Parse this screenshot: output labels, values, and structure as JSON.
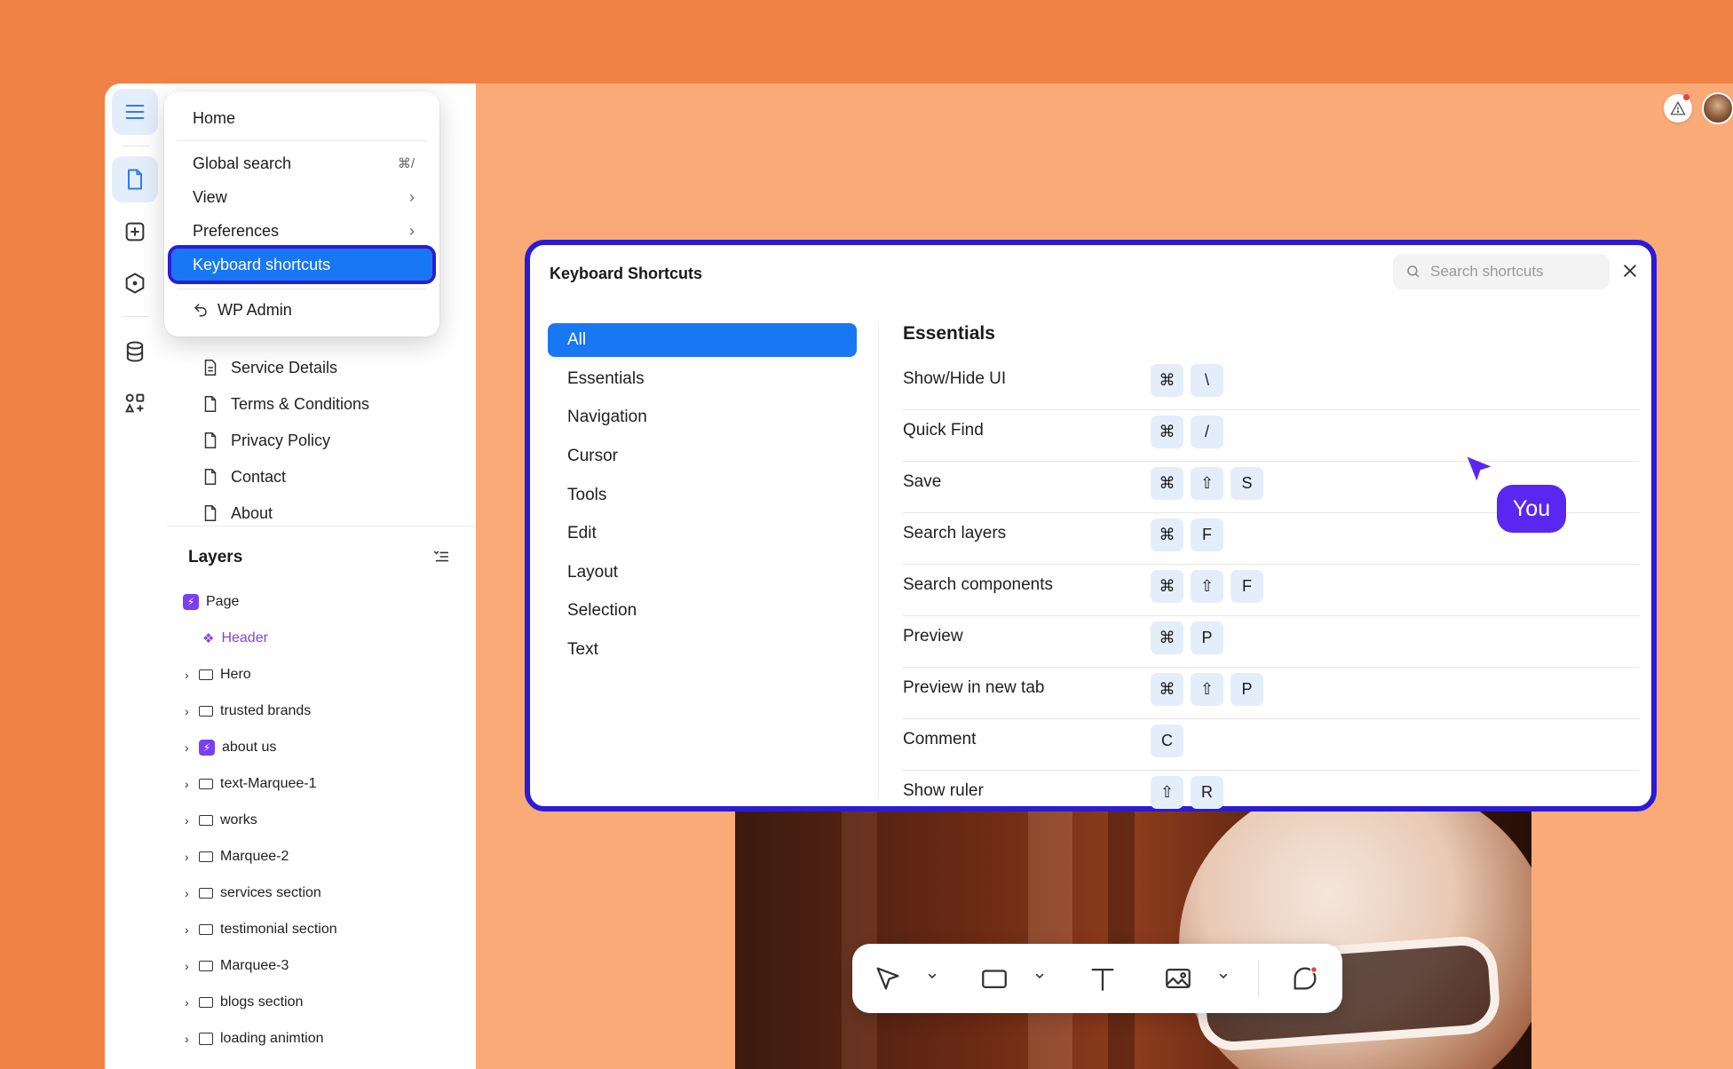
{
  "colors": {
    "background": "#F08246",
    "canvas": "#F9AA77",
    "accent": "#1877F2",
    "focus_outline": "#2A1BD6",
    "cursor": "#5B27F0",
    "component": "#8A3FE3"
  },
  "rail": {
    "items": [
      {
        "icon": "hamburger-menu-icon"
      },
      {
        "icon": "pages-document-icon"
      },
      {
        "icon": "add-square-icon"
      },
      {
        "icon": "components-hexagon-icon"
      },
      {
        "icon": "database-icon"
      },
      {
        "icon": "apps-grid-icon"
      }
    ]
  },
  "menu": {
    "home": "Home",
    "global_search": "Global search",
    "global_search_shortcut": "⌘/",
    "view": "View",
    "preferences": "Preferences",
    "submenu_arrow": "›",
    "keyboard_shortcuts": "Keyboard shortcuts",
    "wp_admin": "WP Admin"
  },
  "pages": {
    "items": [
      {
        "label": "Service Details"
      },
      {
        "label": "Terms & Conditions"
      },
      {
        "label": "Privacy Policy"
      },
      {
        "label": "Contact"
      },
      {
        "label": "About"
      }
    ]
  },
  "layers": {
    "title": "Layers",
    "items": [
      {
        "label": "Page",
        "kind": "page"
      },
      {
        "label": "Header",
        "kind": "component"
      },
      {
        "label": "Hero",
        "kind": "frame"
      },
      {
        "label": "trusted brands",
        "kind": "frame"
      },
      {
        "label": "about us",
        "kind": "bolt"
      },
      {
        "label": "text-Marquee-1",
        "kind": "frame"
      },
      {
        "label": "works",
        "kind": "frame"
      },
      {
        "label": "Marquee-2",
        "kind": "frame"
      },
      {
        "label": "services section",
        "kind": "frame"
      },
      {
        "label": "testimonial section",
        "kind": "frame"
      },
      {
        "label": "Marquee-3",
        "kind": "frame"
      },
      {
        "label": "blogs section",
        "kind": "frame"
      },
      {
        "label": "loading animtion",
        "kind": "box"
      }
    ]
  },
  "modal": {
    "title": "Keyboard Shortcuts",
    "search_placeholder": "Search shortcuts",
    "categories": [
      {
        "label": "All",
        "active": true
      },
      {
        "label": "Essentials"
      },
      {
        "label": "Navigation"
      },
      {
        "label": "Cursor"
      },
      {
        "label": "Tools"
      },
      {
        "label": "Edit"
      },
      {
        "label": "Layout"
      },
      {
        "label": "Selection"
      },
      {
        "label": "Text"
      }
    ],
    "section_title": "Essentials",
    "shortcuts": [
      {
        "label": "Show/Hide UI",
        "keys": [
          "⌘",
          "\\"
        ]
      },
      {
        "label": "Quick Find",
        "keys": [
          "⌘",
          "/"
        ]
      },
      {
        "label": "Save",
        "keys": [
          "⌘",
          "⇧",
          "S"
        ]
      },
      {
        "label": "Search layers",
        "keys": [
          "⌘",
          "F"
        ]
      },
      {
        "label": "Search components",
        "keys": [
          "⌘",
          "⇧",
          "F"
        ]
      },
      {
        "label": "Preview",
        "keys": [
          "⌘",
          "P"
        ]
      },
      {
        "label": "Preview in new tab",
        "keys": [
          "⌘",
          "⇧",
          "P"
        ]
      },
      {
        "label": "Comment",
        "keys": [
          "C"
        ]
      },
      {
        "label": "Show ruler",
        "keys": [
          "⇧",
          "R"
        ]
      }
    ]
  },
  "toolbar": {
    "tools": [
      "select-arrow-icon",
      "rectangle-icon",
      "text-icon",
      "image-icon",
      "comment-icon"
    ]
  },
  "presence": {
    "cursor_label": "You"
  }
}
